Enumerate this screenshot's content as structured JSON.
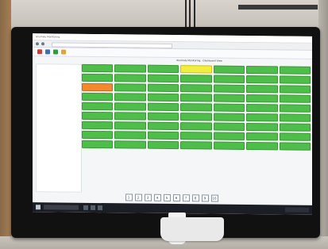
{
  "browser": {
    "tab_title": "Anomaly Monitoring",
    "page_title": "Anomaly Monitoring - Dashboard View"
  },
  "tiles": [
    {
      "c": "green"
    },
    {
      "c": "green"
    },
    {
      "c": "green"
    },
    {
      "c": "yellow"
    },
    {
      "c": "green"
    },
    {
      "c": "green"
    },
    {
      "c": "green"
    },
    {
      "c": "green"
    },
    {
      "c": "green"
    },
    {
      "c": "green"
    },
    {
      "c": "green"
    },
    {
      "c": "green"
    },
    {
      "c": "green"
    },
    {
      "c": "green"
    },
    {
      "c": "orange"
    },
    {
      "c": "green"
    },
    {
      "c": "green"
    },
    {
      "c": "green"
    },
    {
      "c": "green"
    },
    {
      "c": "green"
    },
    {
      "c": "green"
    },
    {
      "c": "green"
    },
    {
      "c": "green"
    },
    {
      "c": "green"
    },
    {
      "c": "green"
    },
    {
      "c": "green"
    },
    {
      "c": "green"
    },
    {
      "c": "green"
    },
    {
      "c": "green"
    },
    {
      "c": "green"
    },
    {
      "c": "green"
    },
    {
      "c": "green"
    },
    {
      "c": "green"
    },
    {
      "c": "green"
    },
    {
      "c": "green"
    },
    {
      "c": "green"
    },
    {
      "c": "green"
    },
    {
      "c": "green"
    },
    {
      "c": "green"
    },
    {
      "c": "green"
    },
    {
      "c": "green"
    },
    {
      "c": "green"
    },
    {
      "c": "green"
    },
    {
      "c": "green"
    },
    {
      "c": "green"
    },
    {
      "c": "green"
    },
    {
      "c": "green"
    },
    {
      "c": "green"
    },
    {
      "c": "green"
    },
    {
      "c": "green"
    },
    {
      "c": "green"
    },
    {
      "c": "green"
    },
    {
      "c": "green"
    },
    {
      "c": "green"
    },
    {
      "c": "green"
    },
    {
      "c": "green"
    },
    {
      "c": "green"
    },
    {
      "c": "green"
    },
    {
      "c": "green"
    },
    {
      "c": "green"
    },
    {
      "c": "green"
    },
    {
      "c": "green"
    },
    {
      "c": "green"
    }
  ],
  "pager": [
    "1",
    "2",
    "3",
    "4",
    "5",
    "6",
    "7",
    "8",
    "9",
    "10"
  ],
  "sticker_text": "",
  "colors": {
    "green": "#4fbd4a",
    "orange": "#f08a30",
    "yellow": "#f2ee3c"
  }
}
